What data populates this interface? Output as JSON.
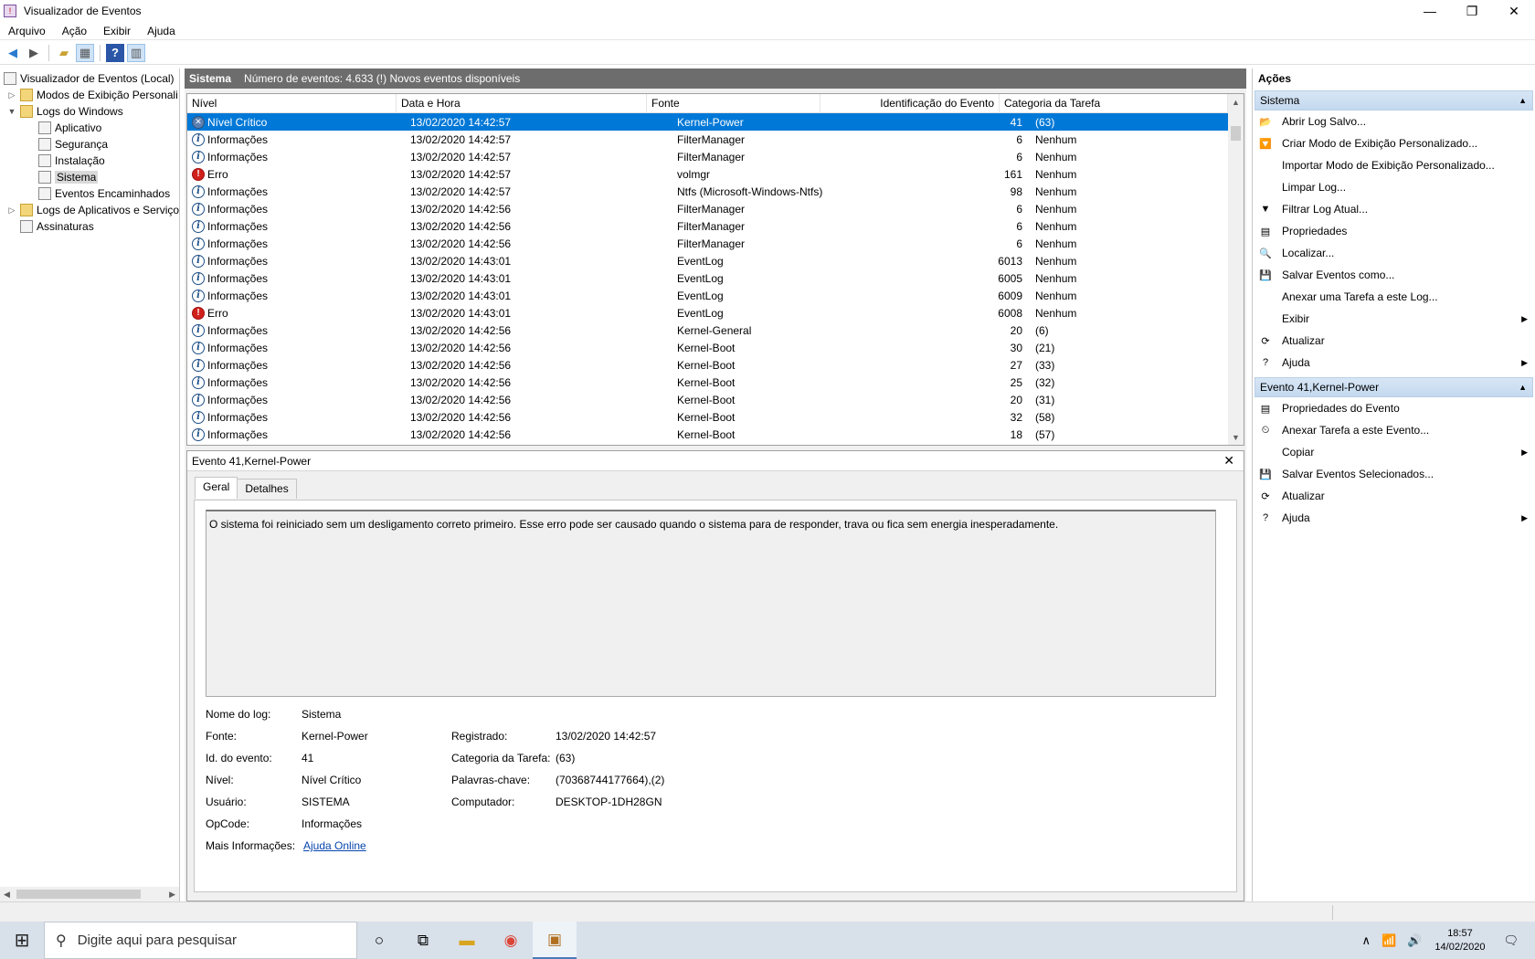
{
  "window": {
    "title": "Visualizador de Eventos",
    "minimize": "—",
    "restore": "❐",
    "close": "✕"
  },
  "menu": [
    "Arquivo",
    "Ação",
    "Exibir",
    "Ajuda"
  ],
  "tree": {
    "root": "Visualizador de Eventos (Local)",
    "custom_views": "Modos de Exibição Personali",
    "windows_logs": "Logs do Windows",
    "windows_children": [
      "Aplicativo",
      "Segurança",
      "Instalação",
      "Sistema",
      "Eventos Encaminhados"
    ],
    "app_logs": "Logs de Aplicativos e Serviço",
    "subscriptions": "Assinaturas"
  },
  "center": {
    "log_name": "Sistema",
    "summary": "Número de eventos: 4.633 (!) Novos eventos disponíveis",
    "columns": [
      "Nível",
      "Data e Hora",
      "Fonte",
      "Identificação do Evento",
      "Categoria da Tarefa"
    ],
    "rows": [
      {
        "level": "Nível Crítico",
        "kind": "crit",
        "date": "13/02/2020 14:42:57",
        "source": "Kernel-Power",
        "id": "41",
        "cat": "(63)"
      },
      {
        "level": "Informações",
        "kind": "info",
        "date": "13/02/2020 14:42:57",
        "source": "FilterManager",
        "id": "6",
        "cat": "Nenhum"
      },
      {
        "level": "Informações",
        "kind": "info",
        "date": "13/02/2020 14:42:57",
        "source": "FilterManager",
        "id": "6",
        "cat": "Nenhum"
      },
      {
        "level": "Erro",
        "kind": "err",
        "date": "13/02/2020 14:42:57",
        "source": "volmgr",
        "id": "161",
        "cat": "Nenhum"
      },
      {
        "level": "Informações",
        "kind": "info",
        "date": "13/02/2020 14:42:57",
        "source": "Ntfs (Microsoft-Windows-Ntfs)",
        "id": "98",
        "cat": "Nenhum"
      },
      {
        "level": "Informações",
        "kind": "info",
        "date": "13/02/2020 14:42:56",
        "source": "FilterManager",
        "id": "6",
        "cat": "Nenhum"
      },
      {
        "level": "Informações",
        "kind": "info",
        "date": "13/02/2020 14:42:56",
        "source": "FilterManager",
        "id": "6",
        "cat": "Nenhum"
      },
      {
        "level": "Informações",
        "kind": "info",
        "date": "13/02/2020 14:42:56",
        "source": "FilterManager",
        "id": "6",
        "cat": "Nenhum"
      },
      {
        "level": "Informações",
        "kind": "info",
        "date": "13/02/2020 14:43:01",
        "source": "EventLog",
        "id": "6013",
        "cat": "Nenhum"
      },
      {
        "level": "Informações",
        "kind": "info",
        "date": "13/02/2020 14:43:01",
        "source": "EventLog",
        "id": "6005",
        "cat": "Nenhum"
      },
      {
        "level": "Informações",
        "kind": "info",
        "date": "13/02/2020 14:43:01",
        "source": "EventLog",
        "id": "6009",
        "cat": "Nenhum"
      },
      {
        "level": "Erro",
        "kind": "err",
        "date": "13/02/2020 14:43:01",
        "source": "EventLog",
        "id": "6008",
        "cat": "Nenhum"
      },
      {
        "level": "Informações",
        "kind": "info",
        "date": "13/02/2020 14:42:56",
        "source": "Kernel-General",
        "id": "20",
        "cat": "(6)"
      },
      {
        "level": "Informações",
        "kind": "info",
        "date": "13/02/2020 14:42:56",
        "source": "Kernel-Boot",
        "id": "30",
        "cat": "(21)"
      },
      {
        "level": "Informações",
        "kind": "info",
        "date": "13/02/2020 14:42:56",
        "source": "Kernel-Boot",
        "id": "27",
        "cat": "(33)"
      },
      {
        "level": "Informações",
        "kind": "info",
        "date": "13/02/2020 14:42:56",
        "source": "Kernel-Boot",
        "id": "25",
        "cat": "(32)"
      },
      {
        "level": "Informações",
        "kind": "info",
        "date": "13/02/2020 14:42:56",
        "source": "Kernel-Boot",
        "id": "20",
        "cat": "(31)"
      },
      {
        "level": "Informações",
        "kind": "info",
        "date": "13/02/2020 14:42:56",
        "source": "Kernel-Boot",
        "id": "32",
        "cat": "(58)"
      },
      {
        "level": "Informações",
        "kind": "info",
        "date": "13/02/2020 14:42:56",
        "source": "Kernel-Boot",
        "id": "18",
        "cat": "(57)"
      }
    ]
  },
  "detail": {
    "title": "Evento 41,Kernel-Power",
    "close": "✕",
    "tabs": [
      "Geral",
      "Detalhes"
    ],
    "message": "O sistema foi reiniciado sem um desligamento correto primeiro. Esse erro pode ser causado quando o sistema para de responder, trava ou fica sem energia inesperadamente.",
    "labels": {
      "log_name": "Nome do log:",
      "source": "Fonte:",
      "event_id": "Id. do evento:",
      "level": "Nível:",
      "user": "Usuário:",
      "opcode": "OpCode:",
      "more_info": "Mais Informações:",
      "logged": "Registrado:",
      "task_category": "Categoria da Tarefa:",
      "keywords": "Palavras-chave:",
      "computer": "Computador:"
    },
    "values": {
      "log_name": "Sistema",
      "source": "Kernel-Power",
      "event_id": "41",
      "level": "Nível Crítico",
      "user": "SISTEMA",
      "opcode": "Informações",
      "more_info": "Ajuda Online",
      "logged": "13/02/2020 14:42:57",
      "task_category": "(63)",
      "keywords": "(70368744177664),(2)",
      "computer": "DESKTOP-1DH28GN"
    }
  },
  "actions": {
    "header": "Ações",
    "section1": "Sistema",
    "items1": [
      {
        "label": "Abrir Log Salvo...",
        "icon": "📂",
        "arrow": ""
      },
      {
        "label": "Criar Modo de Exibição Personalizado...",
        "icon": "🔽",
        "arrow": ""
      },
      {
        "label": "Importar Modo de Exibição Personalizado...",
        "icon": "",
        "arrow": ""
      },
      {
        "label": "Limpar Log...",
        "icon": "",
        "arrow": ""
      },
      {
        "label": "Filtrar Log Atual...",
        "icon": "▼",
        "arrow": ""
      },
      {
        "label": "Propriedades",
        "icon": "▤",
        "arrow": ""
      },
      {
        "label": "Localizar...",
        "icon": "🔍",
        "arrow": ""
      },
      {
        "label": "Salvar Eventos como...",
        "icon": "💾",
        "arrow": ""
      },
      {
        "label": "Anexar uma Tarefa a este Log...",
        "icon": "",
        "arrow": ""
      },
      {
        "label": "Exibir",
        "icon": "",
        "arrow": "▶"
      },
      {
        "label": "Atualizar",
        "icon": "⟳",
        "arrow": ""
      },
      {
        "label": "Ajuda",
        "icon": "?",
        "arrow": "▶"
      }
    ],
    "section2": "Evento 41,Kernel-Power",
    "items2": [
      {
        "label": "Propriedades do Evento",
        "icon": "▤",
        "arrow": ""
      },
      {
        "label": "Anexar Tarefa a este Evento...",
        "icon": "⏲",
        "arrow": ""
      },
      {
        "label": "Copiar",
        "icon": "",
        "arrow": "▶"
      },
      {
        "label": "Salvar Eventos Selecionados...",
        "icon": "💾",
        "arrow": ""
      },
      {
        "label": "Atualizar",
        "icon": "⟳",
        "arrow": ""
      },
      {
        "label": "Ajuda",
        "icon": "?",
        "arrow": "▶"
      }
    ]
  },
  "taskbar": {
    "search_placeholder": "Digite aqui para pesquisar",
    "time": "18:57",
    "date": "14/02/2020"
  }
}
